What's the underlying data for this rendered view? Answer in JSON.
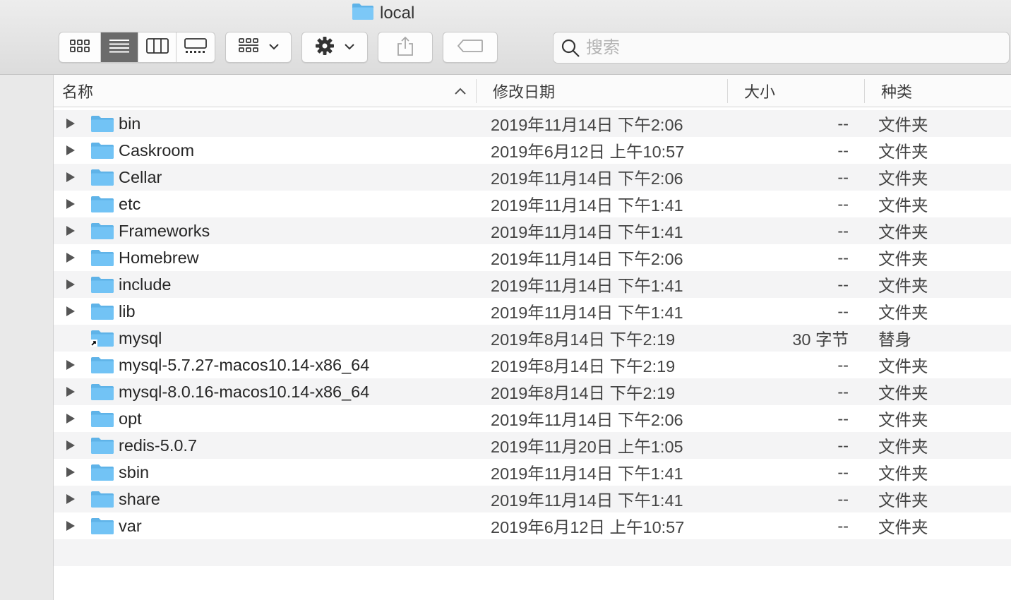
{
  "window": {
    "title": "local",
    "title_icon": "folder-icon"
  },
  "toolbar": {
    "view_buttons": [
      "icon-view-icon",
      "list-view-icon",
      "column-view-icon",
      "gallery-view-icon"
    ],
    "active_view": "list",
    "group_button_icon": "group-grid-icon",
    "action_button_icon": "gear-icon",
    "share_button_icon": "share-icon",
    "tags_button_icon": "tag-icon",
    "search": {
      "value": "",
      "placeholder": "搜索",
      "icon": "search-icon"
    }
  },
  "columns": {
    "name": "名称",
    "modified": "修改日期",
    "size": "大小",
    "kind": "种类",
    "sort_indicator": "chevron-up-icon"
  },
  "files": [
    {
      "name": "bin",
      "modified": "2019年11月14日 下午2:06",
      "size": "--",
      "kind": "文件夹",
      "expandable": true,
      "alias": false
    },
    {
      "name": "Caskroom",
      "modified": "2019年6月12日 上午10:57",
      "size": "--",
      "kind": "文件夹",
      "expandable": true,
      "alias": false
    },
    {
      "name": "Cellar",
      "modified": "2019年11月14日 下午2:06",
      "size": "--",
      "kind": "文件夹",
      "expandable": true,
      "alias": false
    },
    {
      "name": "etc",
      "modified": "2019年11月14日 下午1:41",
      "size": "--",
      "kind": "文件夹",
      "expandable": true,
      "alias": false
    },
    {
      "name": "Frameworks",
      "modified": "2019年11月14日 下午1:41",
      "size": "--",
      "kind": "文件夹",
      "expandable": true,
      "alias": false
    },
    {
      "name": "Homebrew",
      "modified": "2019年11月14日 下午2:06",
      "size": "--",
      "kind": "文件夹",
      "expandable": true,
      "alias": false
    },
    {
      "name": "include",
      "modified": "2019年11月14日 下午1:41",
      "size": "--",
      "kind": "文件夹",
      "expandable": true,
      "alias": false
    },
    {
      "name": "lib",
      "modified": "2019年11月14日 下午1:41",
      "size": "--",
      "kind": "文件夹",
      "expandable": true,
      "alias": false
    },
    {
      "name": "mysql",
      "modified": "2019年8月14日 下午2:19",
      "size": "30 字节",
      "kind": "替身",
      "expandable": false,
      "alias": true
    },
    {
      "name": "mysql-5.7.27-macos10.14-x86_64",
      "modified": "2019年8月14日 下午2:19",
      "size": "--",
      "kind": "文件夹",
      "expandable": true,
      "alias": false
    },
    {
      "name": "mysql-8.0.16-macos10.14-x86_64",
      "modified": "2019年8月14日 下午2:19",
      "size": "--",
      "kind": "文件夹",
      "expandable": true,
      "alias": false
    },
    {
      "name": "opt",
      "modified": "2019年11月14日 下午2:06",
      "size": "--",
      "kind": "文件夹",
      "expandable": true,
      "alias": false
    },
    {
      "name": "redis-5.0.7",
      "modified": "2019年11月20日 上午1:05",
      "size": "--",
      "kind": "文件夹",
      "expandable": true,
      "alias": false
    },
    {
      "name": "sbin",
      "modified": "2019年11月14日 下午1:41",
      "size": "--",
      "kind": "文件夹",
      "expandable": true,
      "alias": false
    },
    {
      "name": "share",
      "modified": "2019年11月14日 下午1:41",
      "size": "--",
      "kind": "文件夹",
      "expandable": true,
      "alias": false
    },
    {
      "name": "var",
      "modified": "2019年6月12日 上午10:57",
      "size": "--",
      "kind": "文件夹",
      "expandable": true,
      "alias": false
    }
  ],
  "colors": {
    "folder": "#72c3f5",
    "folder_tab": "#5fb3e8",
    "active_segment": "#6b6b6b",
    "row_alt": "#f4f4f5"
  }
}
